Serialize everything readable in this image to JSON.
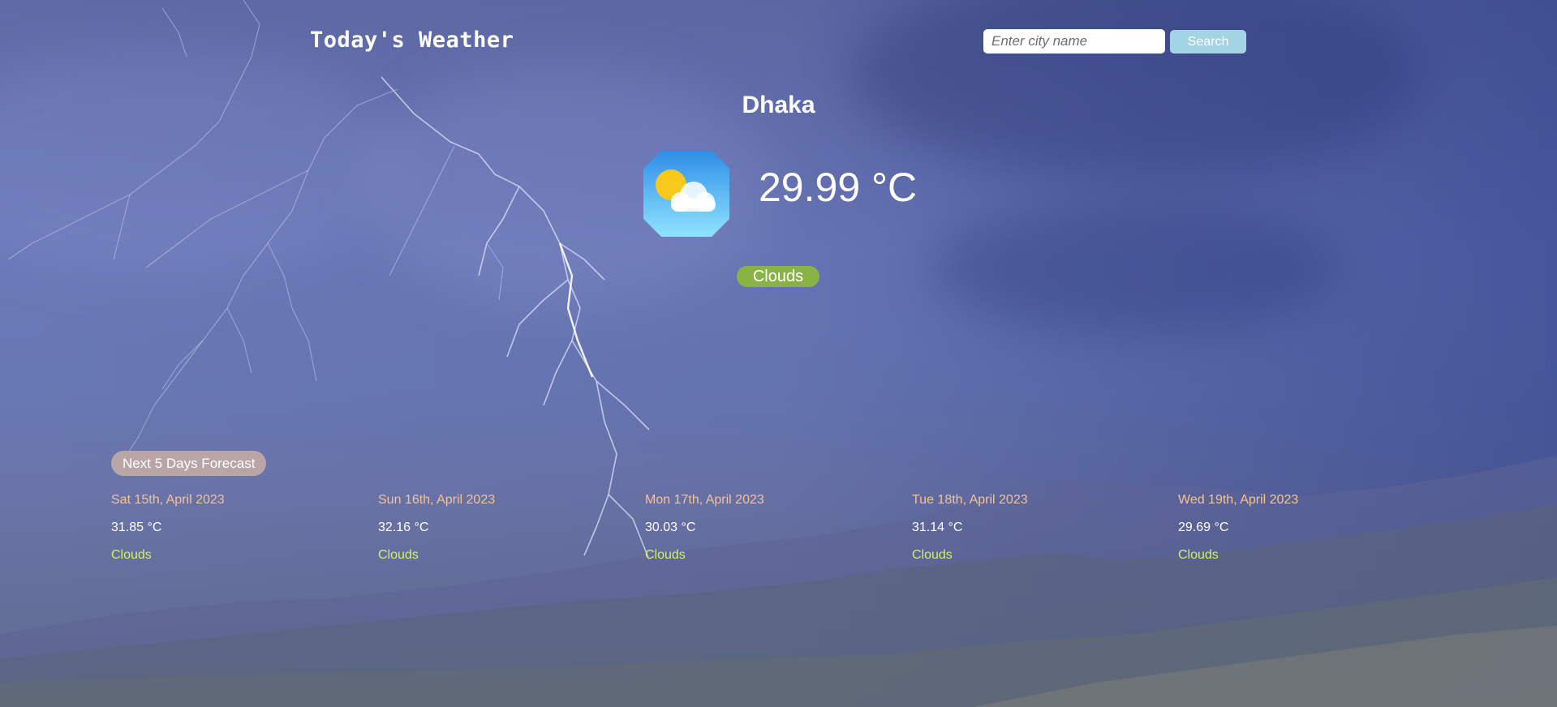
{
  "header": {
    "title": "Today's Weather",
    "search_placeholder": "Enter city name",
    "search_value": "",
    "search_button_label": "Search"
  },
  "current": {
    "city": "Dhaka",
    "temperature": "29.99 °C",
    "condition": "Clouds",
    "icon": "partly-cloudy-icon"
  },
  "forecast": {
    "heading": "Next 5 Days Forecast",
    "days": [
      {
        "date": "Sat 15th, April 2023",
        "temp": "31.85 °C",
        "condition": "Clouds"
      },
      {
        "date": "Sun 16th, April 2023",
        "temp": "32.16 °C",
        "condition": "Clouds"
      },
      {
        "date": "Mon 17th, April 2023",
        "temp": "30.03 °C",
        "condition": "Clouds"
      },
      {
        "date": "Tue 18th, April 2023",
        "temp": "31.14 °C",
        "condition": "Clouds"
      },
      {
        "date": "Wed 19th, April 2023",
        "temp": "29.69 °C",
        "condition": "Clouds"
      }
    ]
  },
  "colors": {
    "condition_badge": "#8ab346",
    "forecast_heading": "#b9a4a6",
    "forecast_date": "#f3c29a",
    "forecast_condition": "#d3f064",
    "search_button": "#a3d4e4"
  }
}
